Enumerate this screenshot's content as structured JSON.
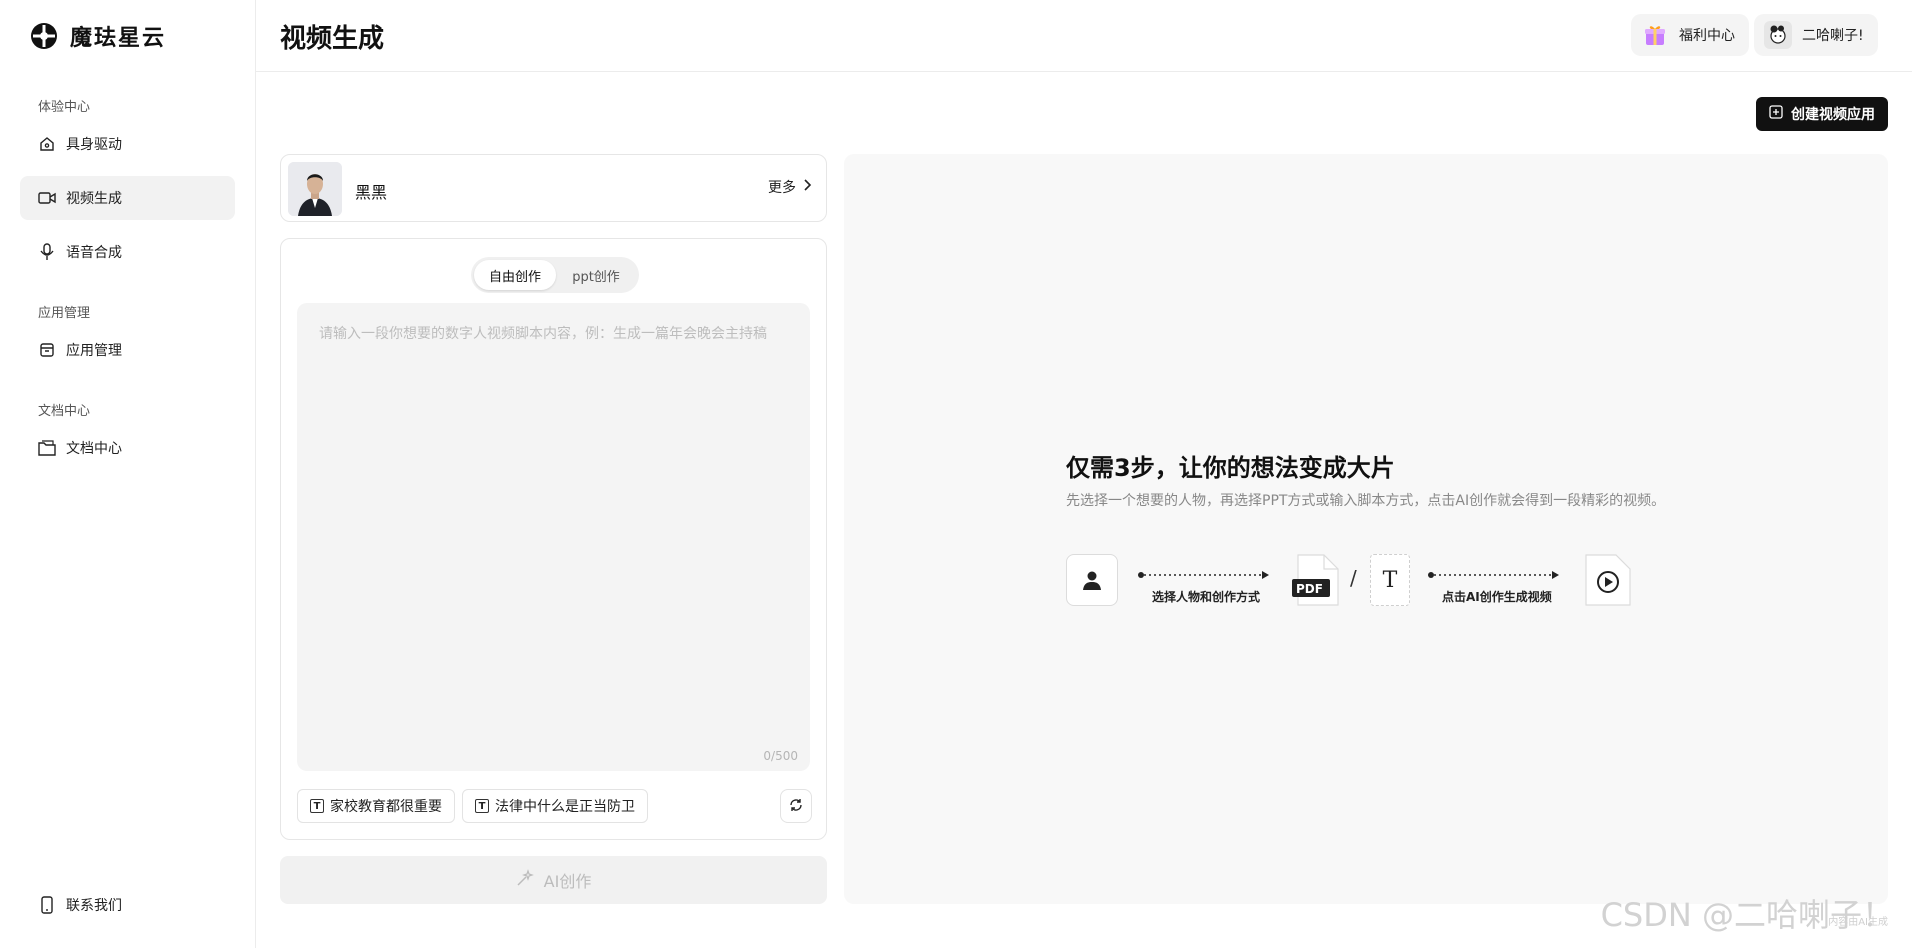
{
  "brand": {
    "name": "魔珐星云"
  },
  "sidebar": {
    "sections": [
      {
        "title": "体验中心",
        "items": [
          {
            "label": "具身驱动",
            "icon": "home-icon"
          },
          {
            "label": "视频生成",
            "icon": "video-icon",
            "active": true
          },
          {
            "label": "语音合成",
            "icon": "microphone-icon"
          }
        ]
      },
      {
        "title": "应用管理",
        "items": [
          {
            "label": "应用管理",
            "icon": "box-icon"
          }
        ]
      },
      {
        "title": "文档中心",
        "items": [
          {
            "label": "文档中心",
            "icon": "folder-icon"
          }
        ]
      }
    ],
    "contact": {
      "label": "联系我们",
      "icon": "phone-icon"
    }
  },
  "header": {
    "title": "视频生成",
    "welfare_label": "福利中心",
    "user_label": "二哈喇子!"
  },
  "main": {
    "create_app_label": "创建视频应用",
    "character": {
      "name": "黑黑",
      "more_label": "更多"
    },
    "tabs": [
      "自由创作",
      "ppt创作"
    ],
    "textarea_placeholder": "请输入一段你想要的数字人视频脚本内容，例：生成一篇年会晚会主持稿",
    "textarea_value": "",
    "counter": "0/500",
    "suggestions": [
      "家校教育都很重要",
      "法律中什么是正当防卫"
    ],
    "ai_button_label": "AI创作"
  },
  "preview": {
    "title": "仅需3步，让你的想法变成大片",
    "subtitle": "先选择一个想要的人物，再选择PPT方式或输入脚本方式，点击AI创作就会得到一段精彩的视频。",
    "step1_label": "选择人物和创作方式",
    "step2_label": "点击AI创作生成视频",
    "pdf_label": "PDF",
    "slash": "/",
    "text_icon_label": "T"
  },
  "footer": {
    "note": "内容由AI生成",
    "watermark": "CSDN @二哈喇子！"
  },
  "colors": {
    "primary": "#111111",
    "active_bg": "#f2f2f2",
    "preview_bg": "#f8f8f8"
  }
}
